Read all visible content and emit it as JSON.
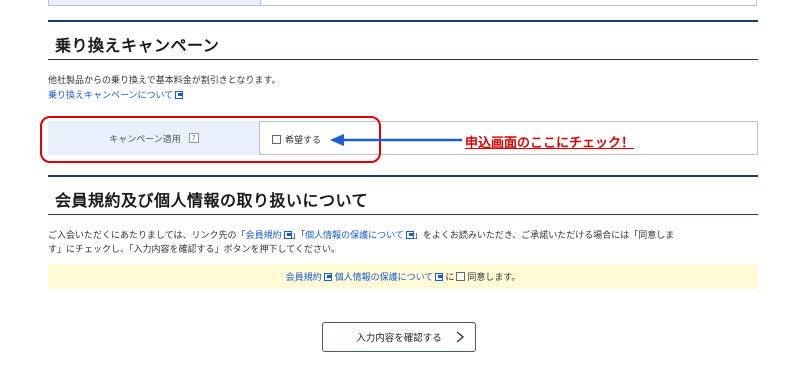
{
  "campaign": {
    "heading": "乗り換えキャンペーン",
    "description": "他社製品からの乗り換えで基本料金が割引きとなります。",
    "link_text": "乗り換えキャンペーンについて",
    "field_label": "キャンペーン適用",
    "help_mark": "?",
    "checkbox_label": "希望する",
    "annotation": "申込画面のここにチェック！"
  },
  "terms": {
    "heading": "会員規約及び個人情報の取り扱いについて",
    "line1_a": "ご入会いただくにあたりましては、リンク先の「",
    "line1_link1": "会員規約",
    "line1_b": "」「",
    "line1_link2": "個人情報の保護について",
    "line1_c": "」をよくお読みいただき、ご承諾いただける場合には「同意しま",
    "line2": "す」にチェックし、「入力内容を確認する」ボタンを押下してください。",
    "consent_link1": "会員規約",
    "consent_link2": "個人情報の保護について",
    "consent_suffix1": "に",
    "consent_suffix2": "同意します。"
  },
  "actions": {
    "confirm_label": "入力内容を確認する"
  },
  "colors": {
    "accent_rule": "#1f3a63",
    "link": "#1a5bd6",
    "annotation": "#e00000",
    "consent_bg": "#fffbd6",
    "label_bg": "#e9f0fb"
  }
}
